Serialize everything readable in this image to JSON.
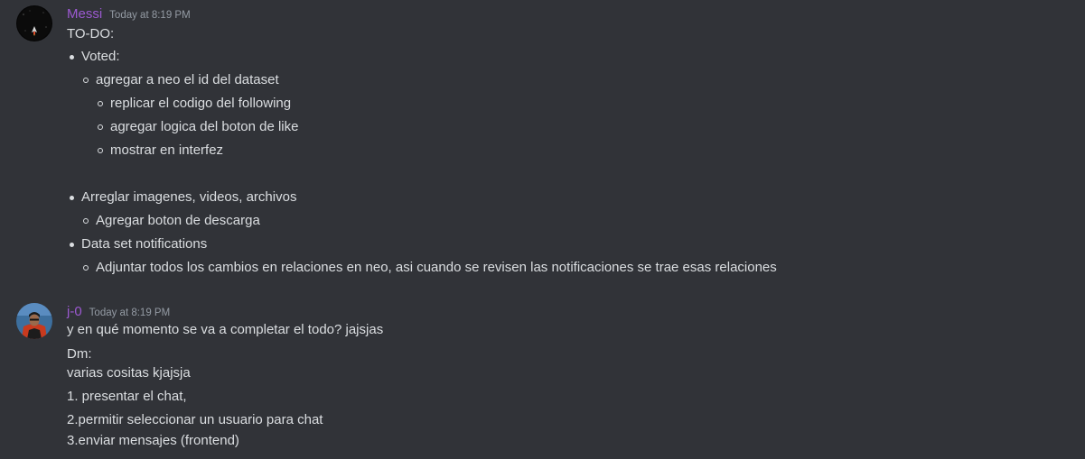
{
  "messages": [
    {
      "username": "Messi",
      "timestamp": "Today at 8:19 PM",
      "avatar_icon": "black-avatar-with-rocket-icon",
      "title": "TO-DO:",
      "items": [
        "Voted:",
        "agregar a neo el id del dataset",
        "replicar el codigo del following",
        "agregar logica del boton de like",
        "mostrar en interfez",
        "Arreglar imagenes, videos, archivos",
        "Agregar boton de descarga",
        "Data set notifications",
        "Adjuntar todos los cambios en relaciones en neo, asi cuando se revisen las notificaciones se trae esas relaciones"
      ]
    },
    {
      "username": "j-0",
      "timestamp": "Today at 8:19 PM",
      "avatar_icon": "person-photo-avatar-icon",
      "lines": [
        "y en qué momento se va a completar el todo? jajsjas",
        "Dm:",
        "varias cositas kjajsja",
        "1. presentar el chat,",
        "2.permitir seleccionar un usuario para chat",
        "3.enviar mensajes (frontend)"
      ]
    }
  ],
  "colors": {
    "background": "#313338",
    "username": "#9b59d0",
    "text": "#dbdee1",
    "timestamp": "#949ba4"
  }
}
